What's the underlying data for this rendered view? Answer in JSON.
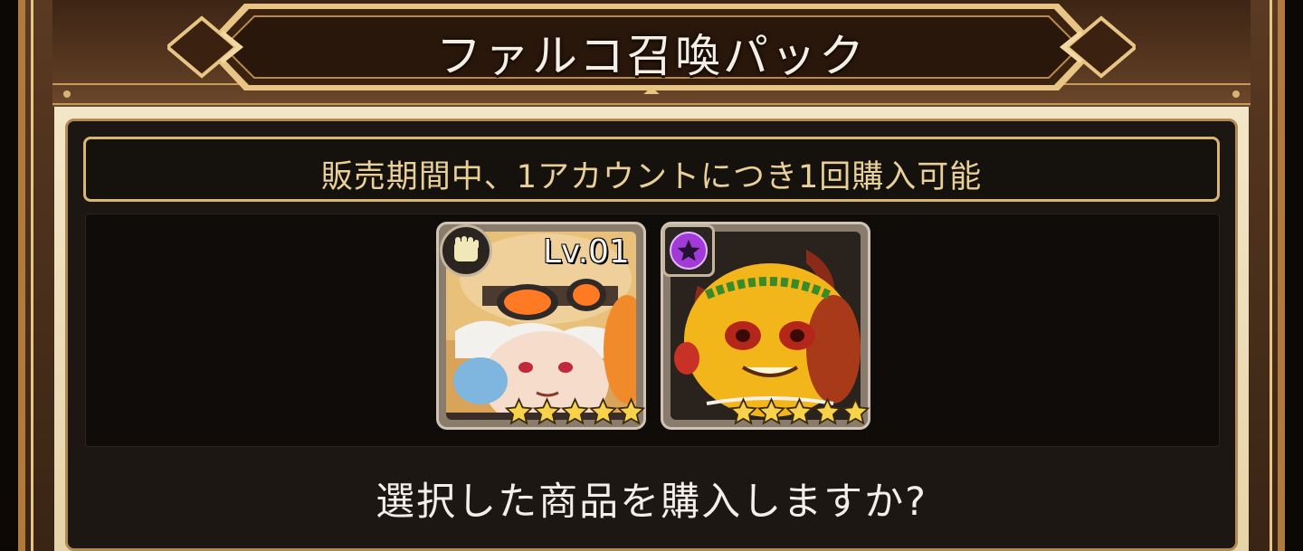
{
  "dialog": {
    "title": "ファルコ召喚パック",
    "notice": "販売期間中、1アカウントにつき1回購入可能",
    "confirm_question": "選択した商品を購入しますか?"
  },
  "items": [
    {
      "name": "hero-card",
      "class_icon": "fist-icon",
      "level_label": "Lv.01",
      "stars": 5,
      "portrait": "white-haired hero with orange goggles"
    },
    {
      "name": "pet-card",
      "class_icon": "purple-star-icon",
      "stars": 5,
      "portrait": "yellow horned creature with laurel crown"
    }
  ],
  "colors": {
    "frame_gold": "#e9c585",
    "panel_dark": "#1c1713",
    "notice_text": "#e9cf98",
    "star_gold": "#f7d24a",
    "badge_purple": "#a23ad8"
  }
}
